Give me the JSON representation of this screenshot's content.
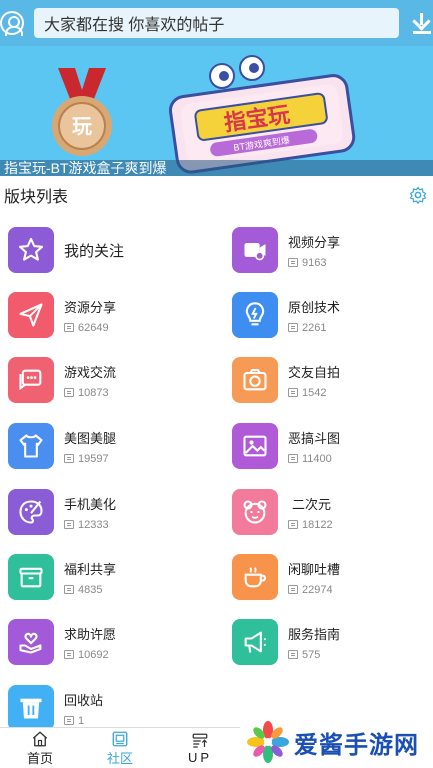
{
  "search": {
    "placeholder": "大家都在搜  你喜欢的帖子"
  },
  "banner": {
    "caption": "指宝玩-BT游戏盒子爽到爆",
    "logo_text": "指宝玩",
    "sub_text": "BT游戏爽到爆",
    "medal_text": "玩"
  },
  "section": {
    "title": "版块列表"
  },
  "forums": [
    {
      "label": "我的关注",
      "count": "",
      "color": "#8d5bd6",
      "icon": "star-icon"
    },
    {
      "label": "视频分享",
      "count": "9163",
      "color": "#a35bd8",
      "icon": "video-icon"
    },
    {
      "label": "资源分享",
      "count": "62649",
      "color": "#f25b6b",
      "icon": "send-icon"
    },
    {
      "label": "原创技术",
      "count": "2261",
      "color": "#3d8ef0",
      "icon": "bulb-icon"
    },
    {
      "label": "游戏交流",
      "count": "10873",
      "color": "#f06272",
      "icon": "chat-icon"
    },
    {
      "label": "交友自拍",
      "count": "1542",
      "color": "#f79a55",
      "icon": "camera-icon"
    },
    {
      "label": "美图美腿",
      "count": "19597",
      "color": "#4a8ff0",
      "icon": "shirt-icon"
    },
    {
      "label": "恶搞斗图",
      "count": "11400",
      "color": "#b05ad8",
      "icon": "image-icon"
    },
    {
      "label": "手机美化",
      "count": "12333",
      "color": "#8a5cd6",
      "icon": "palette-icon"
    },
    {
      "label": "二次元",
      "count": "18122",
      "color": "#f27b9b",
      "icon": "bear-icon"
    },
    {
      "label": "福利共享",
      "count": "4835",
      "color": "#2fbf9a",
      "icon": "gift-icon"
    },
    {
      "label": "闲聊吐槽",
      "count": "22974",
      "color": "#f7934a",
      "icon": "cup-icon"
    },
    {
      "label": "求助许愿",
      "count": "10692",
      "color": "#a25ad8",
      "icon": "heart-hand-icon"
    },
    {
      "label": "服务指南",
      "count": "575",
      "color": "#2fbf9a",
      "icon": "megaphone-icon"
    },
    {
      "label": "回收站",
      "count": "1",
      "color": "#42b0f5",
      "icon": "trash-icon"
    }
  ],
  "tabs": [
    {
      "label": "首页",
      "icon": "home-icon",
      "active": false
    },
    {
      "label": "社区",
      "icon": "community-icon",
      "active": true
    },
    {
      "label": "UP",
      "icon": "up-icon",
      "active": false
    }
  ],
  "watermark": {
    "text": "爱酱手游网"
  },
  "colors": {
    "top_bar": "#5ab8e6",
    "accent": "#3aa6dc",
    "banner_bg": "#5cc6f2"
  }
}
